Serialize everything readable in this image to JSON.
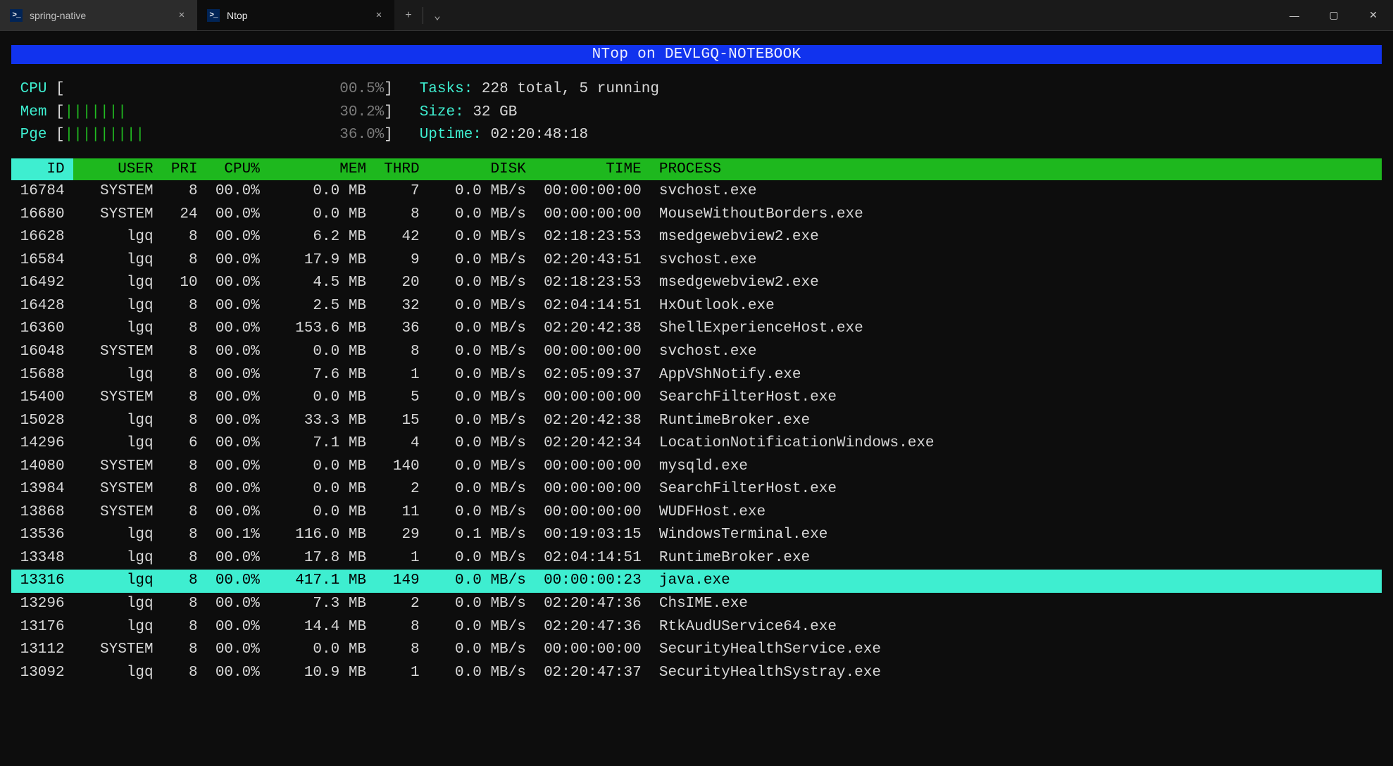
{
  "tabs": [
    {
      "title": "spring-native",
      "active": false
    },
    {
      "title": "Ntop",
      "active": true
    }
  ],
  "banner": "NTop on DEVLGQ-NOTEBOOK",
  "meters": {
    "cpu": {
      "label": "CPU",
      "bars": 0,
      "pct": "00.5%"
    },
    "mem": {
      "label": "Mem",
      "bars": 7,
      "pct": "30.2%"
    },
    "pge": {
      "label": "Pge",
      "bars": 9,
      "pct": "36.0%"
    }
  },
  "sysinfo": {
    "tasks_label": "Tasks:",
    "tasks_value": "228 total, 5 running",
    "size_label": "Size:",
    "size_value": "32 GB",
    "uptime_label": "Uptime:",
    "uptime_value": "02:20:48:18"
  },
  "columns": {
    "id": "ID",
    "user": "USER",
    "pri": "PRI",
    "cpu": "CPU%",
    "mem": "MEM",
    "thrd": "THRD",
    "disk": "DISK",
    "time": "TIME",
    "proc": "PROCESS"
  },
  "processes": [
    {
      "id": "16784",
      "user": "SYSTEM",
      "pri": "8",
      "cpu": "00.0%",
      "mem": "0.0 MB",
      "thrd": "7",
      "disk": "0.0 MB/s",
      "time": "00:00:00:00",
      "proc": "svchost.exe",
      "selected": false
    },
    {
      "id": "16680",
      "user": "SYSTEM",
      "pri": "24",
      "cpu": "00.0%",
      "mem": "0.0 MB",
      "thrd": "8",
      "disk": "0.0 MB/s",
      "time": "00:00:00:00",
      "proc": "MouseWithoutBorders.exe",
      "selected": false
    },
    {
      "id": "16628",
      "user": "lgq",
      "pri": "8",
      "cpu": "00.0%",
      "mem": "6.2 MB",
      "thrd": "42",
      "disk": "0.0 MB/s",
      "time": "02:18:23:53",
      "proc": "msedgewebview2.exe",
      "selected": false
    },
    {
      "id": "16584",
      "user": "lgq",
      "pri": "8",
      "cpu": "00.0%",
      "mem": "17.9 MB",
      "thrd": "9",
      "disk": "0.0 MB/s",
      "time": "02:20:43:51",
      "proc": "svchost.exe",
      "selected": false
    },
    {
      "id": "16492",
      "user": "lgq",
      "pri": "10",
      "cpu": "00.0%",
      "mem": "4.5 MB",
      "thrd": "20",
      "disk": "0.0 MB/s",
      "time": "02:18:23:53",
      "proc": "msedgewebview2.exe",
      "selected": false
    },
    {
      "id": "16428",
      "user": "lgq",
      "pri": "8",
      "cpu": "00.0%",
      "mem": "2.5 MB",
      "thrd": "32",
      "disk": "0.0 MB/s",
      "time": "02:04:14:51",
      "proc": "HxOutlook.exe",
      "selected": false
    },
    {
      "id": "16360",
      "user": "lgq",
      "pri": "8",
      "cpu": "00.0%",
      "mem": "153.6 MB",
      "thrd": "36",
      "disk": "0.0 MB/s",
      "time": "02:20:42:38",
      "proc": "ShellExperienceHost.exe",
      "selected": false
    },
    {
      "id": "16048",
      "user": "SYSTEM",
      "pri": "8",
      "cpu": "00.0%",
      "mem": "0.0 MB",
      "thrd": "8",
      "disk": "0.0 MB/s",
      "time": "00:00:00:00",
      "proc": "svchost.exe",
      "selected": false
    },
    {
      "id": "15688",
      "user": "lgq",
      "pri": "8",
      "cpu": "00.0%",
      "mem": "7.6 MB",
      "thrd": "1",
      "disk": "0.0 MB/s",
      "time": "02:05:09:37",
      "proc": "AppVShNotify.exe",
      "selected": false
    },
    {
      "id": "15400",
      "user": "SYSTEM",
      "pri": "8",
      "cpu": "00.0%",
      "mem": "0.0 MB",
      "thrd": "5",
      "disk": "0.0 MB/s",
      "time": "00:00:00:00",
      "proc": "SearchFilterHost.exe",
      "selected": false
    },
    {
      "id": "15028",
      "user": "lgq",
      "pri": "8",
      "cpu": "00.0%",
      "mem": "33.3 MB",
      "thrd": "15",
      "disk": "0.0 MB/s",
      "time": "02:20:42:38",
      "proc": "RuntimeBroker.exe",
      "selected": false
    },
    {
      "id": "14296",
      "user": "lgq",
      "pri": "6",
      "cpu": "00.0%",
      "mem": "7.1 MB",
      "thrd": "4",
      "disk": "0.0 MB/s",
      "time": "02:20:42:34",
      "proc": "LocationNotificationWindows.exe",
      "selected": false
    },
    {
      "id": "14080",
      "user": "SYSTEM",
      "pri": "8",
      "cpu": "00.0%",
      "mem": "0.0 MB",
      "thrd": "140",
      "disk": "0.0 MB/s",
      "time": "00:00:00:00",
      "proc": "mysqld.exe",
      "selected": false
    },
    {
      "id": "13984",
      "user": "SYSTEM",
      "pri": "8",
      "cpu": "00.0%",
      "mem": "0.0 MB",
      "thrd": "2",
      "disk": "0.0 MB/s",
      "time": "00:00:00:00",
      "proc": "SearchFilterHost.exe",
      "selected": false
    },
    {
      "id": "13868",
      "user": "SYSTEM",
      "pri": "8",
      "cpu": "00.0%",
      "mem": "0.0 MB",
      "thrd": "11",
      "disk": "0.0 MB/s",
      "time": "00:00:00:00",
      "proc": "WUDFHost.exe",
      "selected": false
    },
    {
      "id": "13536",
      "user": "lgq",
      "pri": "8",
      "cpu": "00.1%",
      "mem": "116.0 MB",
      "thrd": "29",
      "disk": "0.1 MB/s",
      "time": "00:19:03:15",
      "proc": "WindowsTerminal.exe",
      "selected": false
    },
    {
      "id": "13348",
      "user": "lgq",
      "pri": "8",
      "cpu": "00.0%",
      "mem": "17.8 MB",
      "thrd": "1",
      "disk": "0.0 MB/s",
      "time": "02:04:14:51",
      "proc": "RuntimeBroker.exe",
      "selected": false
    },
    {
      "id": "13316",
      "user": "lgq",
      "pri": "8",
      "cpu": "00.0%",
      "mem": "417.1 MB",
      "thrd": "149",
      "disk": "0.0 MB/s",
      "time": "00:00:00:23",
      "proc": "java.exe",
      "selected": true
    },
    {
      "id": "13296",
      "user": "lgq",
      "pri": "8",
      "cpu": "00.0%",
      "mem": "7.3 MB",
      "thrd": "2",
      "disk": "0.0 MB/s",
      "time": "02:20:47:36",
      "proc": "ChsIME.exe",
      "selected": false
    },
    {
      "id": "13176",
      "user": "lgq",
      "pri": "8",
      "cpu": "00.0%",
      "mem": "14.4 MB",
      "thrd": "8",
      "disk": "0.0 MB/s",
      "time": "02:20:47:36",
      "proc": "RtkAudUService64.exe",
      "selected": false
    },
    {
      "id": "13112",
      "user": "SYSTEM",
      "pri": "8",
      "cpu": "00.0%",
      "mem": "0.0 MB",
      "thrd": "8",
      "disk": "0.0 MB/s",
      "time": "00:00:00:00",
      "proc": "SecurityHealthService.exe",
      "selected": false
    },
    {
      "id": "13092",
      "user": "lgq",
      "pri": "8",
      "cpu": "00.0%",
      "mem": "10.9 MB",
      "thrd": "1",
      "disk": "0.0 MB/s",
      "time": "02:20:47:37",
      "proc": "SecurityHealthSystray.exe",
      "selected": false
    }
  ]
}
